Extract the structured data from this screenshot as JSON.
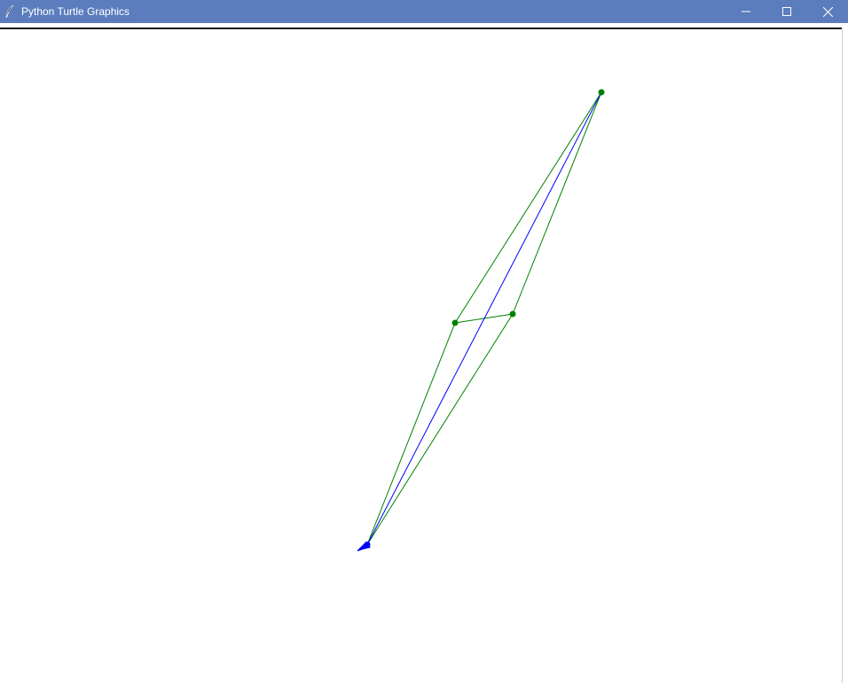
{
  "window": {
    "title": "Python Turtle Graphics",
    "icon": "feather-icon",
    "controls": {
      "minimize_icon": "minimize-icon",
      "maximize_icon": "maximize-icon",
      "close_icon": "close-icon"
    },
    "titlebar_color": "#5b7dbd"
  },
  "canvas": {
    "background": "#ffffff",
    "line_colors": {
      "outline": "#008000",
      "diagonal": "#0000ff"
    },
    "dots": [
      "green",
      "green",
      "green"
    ],
    "turtle": {
      "shape": "classic-arrow",
      "color": "#0000ff"
    }
  }
}
